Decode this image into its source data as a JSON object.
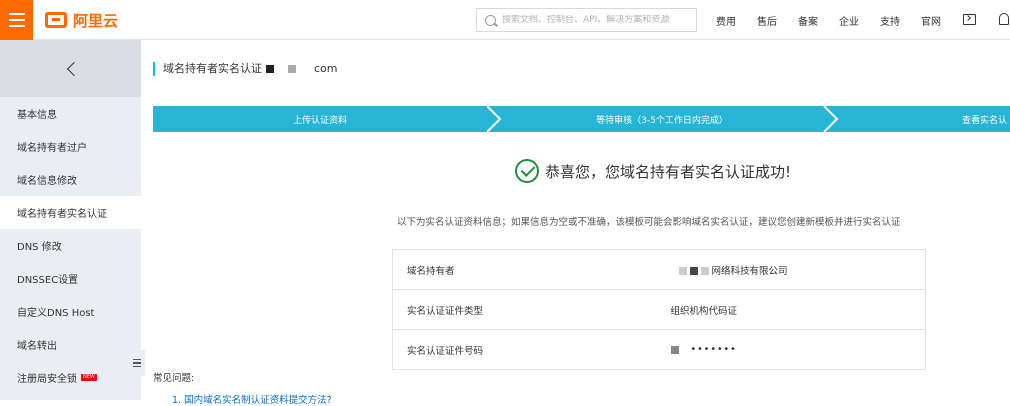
{
  "header": {
    "logo_text": "阿里云",
    "search_placeholder": "搜索文档、控制台、API、解决方案和资源",
    "nav": [
      "费用",
      "售后",
      "备案",
      "企业",
      "支持",
      "官网"
    ]
  },
  "sidebar": {
    "items": [
      {
        "label": "基本信息"
      },
      {
        "label": "域名持有者过户"
      },
      {
        "label": "域名信息修改"
      },
      {
        "label": "域名持有者实名认证",
        "active": true
      },
      {
        "label": "DNS 修改"
      },
      {
        "label": "DNSSEC设置"
      },
      {
        "label": "自定义DNS Host"
      },
      {
        "label": "域名转出"
      },
      {
        "label": "注册局安全锁",
        "badge": "NEW"
      }
    ]
  },
  "main": {
    "title_prefix": "域名持有者实名认证",
    "title_suffix": "com",
    "steps": [
      "上传认证资料",
      "等待审核（3-5个工作日内完成）",
      "查看实名认"
    ],
    "success_message": "恭喜您，您域名持有者实名认证成功!",
    "notice": "以下为实名认证资料信息；如果信息为空或不准确，该模板可能会影响域名实名认证，建议您创建新模板并进行实名认证",
    "table": [
      {
        "key": "域名持有者",
        "value": "网络科技有限公司"
      },
      {
        "key": "实名认证证件类型",
        "value": "组织机构代码证"
      },
      {
        "key": "实名认证证件号码",
        "value": "•••••••"
      }
    ],
    "faq_label": "常见问题:",
    "faq_link": "1. 国内域名实名制认证资料提交方法?"
  },
  "colors": {
    "brand": "#ff6a00",
    "step_bg": "#27b5d6",
    "success": "#1e8e3e",
    "link": "#0070cc"
  }
}
